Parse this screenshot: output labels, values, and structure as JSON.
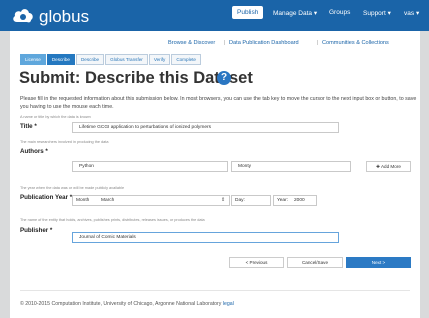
{
  "brand": "globus",
  "nav": {
    "publish": "Publish",
    "manage_data": "Manage Data",
    "groups": "Groups",
    "support": "Support",
    "user": "vas"
  },
  "subnav": {
    "browse": "Browse & Discover",
    "dashboard": "Data Publication Dashboard",
    "communities": "Communities & Collections",
    "separator": "|"
  },
  "steps": [
    "License",
    "Describe",
    "Describe",
    "Globus Transfer",
    "Verify",
    "Complete"
  ],
  "page_title": "Submit: Describe this Dataset",
  "intro": "Please fill in the requested information about this submission below. In most browsers, you can use the tab key to move the cursor to the next input box or button, to save you having to use the mouse each time.",
  "form": {
    "title": {
      "hint": "A name or title by which the data is known",
      "label": "Title *",
      "value": "Lifetime GCGI application to perturbations of ionized polymers"
    },
    "authors": {
      "hint": "The main researchers involved in producing the data",
      "label": "Authors *",
      "first": "Python",
      "last": "Monty",
      "add_label": "Add More"
    },
    "year": {
      "hint": "The year when the data was or will be made publicly available",
      "label": "Publication Year *",
      "month_label": "Month",
      "month_value": "March",
      "day_label": "Day:",
      "year_label": "Year:",
      "year_value": "2000"
    },
    "publisher": {
      "hint": "The name of the entity that holds, archives, publishes prints, distributes, releases issues, or produces the data",
      "label": "Publisher *",
      "value": "Journal of Comic Materials"
    }
  },
  "buttons": {
    "previous": "< Previous",
    "cancel_save": "Cancel/Save",
    "next": "Next >"
  },
  "footer": {
    "text": "© 2010-2015 Computation Institute, University of Chicago, Argonne National Laboratory",
    "link": "legal"
  }
}
